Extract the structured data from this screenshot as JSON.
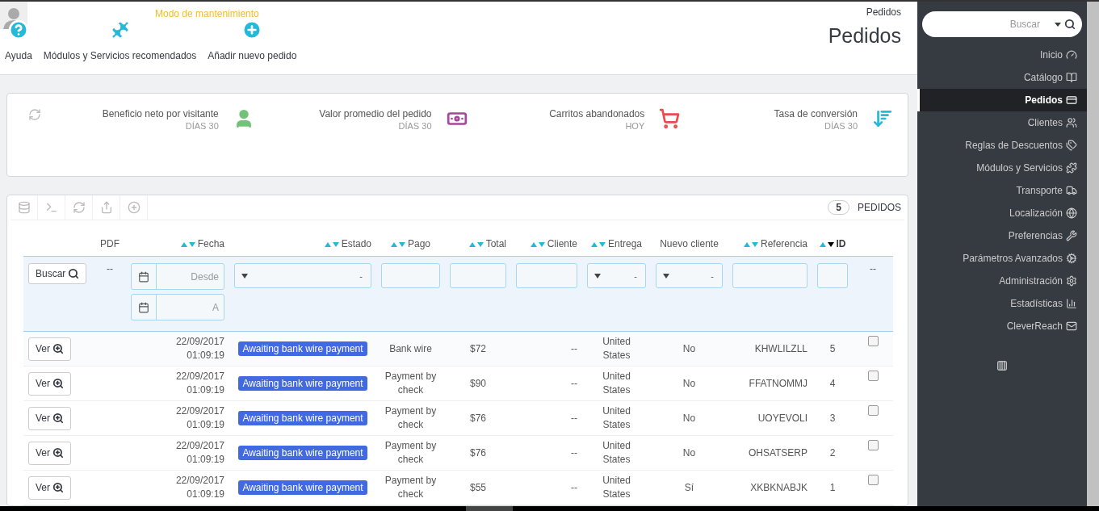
{
  "header": {
    "maintenance": "Modo de mantenimiento",
    "toolbar": [
      {
        "label": "Ayuda"
      },
      {
        "label": "Módulos y Servicios recomendados"
      },
      {
        "label": "Añadir nuevo pedido"
      }
    ],
    "breadcrumb": "Pedidos",
    "title": "Pedidos"
  },
  "kpis": [
    {
      "label": "Beneficio neto por visitante",
      "period": "DÍAS 30",
      "color": "#72c279"
    },
    {
      "label": "Valor promedio del pedido",
      "period": "DÍAS 30",
      "color": "#a5479b"
    },
    {
      "label": "Carritos abandonados",
      "period": "HOY",
      "color": "#e94c4c"
    },
    {
      "label": "Tasa de conversión",
      "period": "DÍAS 30",
      "color": "#25b9d7"
    }
  ],
  "table": {
    "count": "5",
    "count_label": "PEDIDOS",
    "columns": [
      {
        "filter": {
          "kind": "button",
          "label": "Buscar"
        }
      },
      {
        "label": "PDF",
        "sortable": false,
        "filter": {
          "kind": "dash",
          "text": "--"
        }
      },
      {
        "label": "Fecha",
        "sortable": true,
        "sorted_desc": false,
        "filter": {
          "kind": "date",
          "placeholders": [
            "Desde",
            "A"
          ]
        }
      },
      {
        "label": "Estado",
        "sortable": true,
        "sorted_desc": false,
        "filter": {
          "kind": "select",
          "value": "-"
        }
      },
      {
        "label": "Pago",
        "sortable": true,
        "sorted_desc": false,
        "filter": {
          "kind": "text"
        }
      },
      {
        "label": "Total",
        "sortable": true,
        "sorted_desc": false,
        "filter": {
          "kind": "text"
        }
      },
      {
        "label": "Cliente",
        "sortable": true,
        "sorted_desc": false,
        "filter": {
          "kind": "text"
        }
      },
      {
        "label": "Entrega",
        "sortable": true,
        "sorted_desc": false,
        "filter": {
          "kind": "select",
          "value": "-"
        }
      },
      {
        "label": "Nuevo cliente",
        "sortable": false,
        "filter": {
          "kind": "select",
          "value": "-"
        }
      },
      {
        "label": "Referencia",
        "sortable": true,
        "sorted_desc": false,
        "filter": {
          "kind": "text"
        }
      },
      {
        "label": "ID",
        "sortable": true,
        "sorted_desc": true,
        "filter": {
          "kind": "text"
        }
      },
      {
        "filter": {
          "kind": "dash",
          "text": "--"
        }
      }
    ],
    "rows": [
      {
        "action": "Ver",
        "date": "22/09/2017",
        "time": "01:09:19",
        "status": "Awaiting bank wire payment",
        "payment": "Bank wire",
        "total": "$72",
        "customer": "--",
        "delivery": "United States",
        "new_customer": "No",
        "reference": "KHWLILZLL",
        "id": "5",
        "checked": false
      },
      {
        "action": "Ver",
        "date": "22/09/2017",
        "time": "01:09:19",
        "status": "Awaiting bank wire payment",
        "payment": "Payment by check",
        "total": "$90",
        "customer": "--",
        "delivery": "United States",
        "new_customer": "No",
        "reference": "FFATNOMMJ",
        "id": "4",
        "checked": false
      },
      {
        "action": "Ver",
        "date": "22/09/2017",
        "time": "01:09:19",
        "status": "Awaiting bank wire payment",
        "payment": "Payment by check",
        "total": "$76",
        "customer": "--",
        "delivery": "United States",
        "new_customer": "No",
        "reference": "UOYEVOLI",
        "id": "3",
        "checked": false
      },
      {
        "action": "Ver",
        "date": "22/09/2017",
        "time": "01:09:19",
        "status": "Awaiting bank wire payment",
        "payment": "Payment by check",
        "total": "$76",
        "customer": "--",
        "delivery": "United States",
        "new_customer": "No",
        "reference": "OHSATSERP",
        "id": "2",
        "checked": false
      },
      {
        "action": "Ver",
        "date": "22/09/2017",
        "time": "01:09:19",
        "status": "Awaiting bank wire payment",
        "payment": "Payment by check",
        "total": "$55",
        "customer": "--",
        "delivery": "United States",
        "new_customer": "Sí",
        "reference": "XKBKNABJK",
        "id": "1",
        "checked": false
      }
    ]
  },
  "sidebar": {
    "search": {
      "placeholder": "Buscar"
    },
    "items": [
      {
        "label": "Inicio",
        "selected": false
      },
      {
        "label": "Catálogo",
        "selected": false
      },
      {
        "label": "Pedidos",
        "selected": true
      },
      {
        "label": "Clientes",
        "selected": false
      },
      {
        "label": "Reglas de Descuentos",
        "selected": false
      },
      {
        "label": "Módulos y Servicios",
        "selected": false
      },
      {
        "label": "Transporte",
        "selected": false
      },
      {
        "label": "Localización",
        "selected": false
      },
      {
        "label": "Preferencias",
        "selected": false
      },
      {
        "label": "Parámetros Avanzados",
        "selected": false
      },
      {
        "label": "Administración",
        "selected": false
      },
      {
        "label": "Estadísticas",
        "selected": false
      },
      {
        "label": "CleverReach",
        "selected": false
      }
    ]
  }
}
